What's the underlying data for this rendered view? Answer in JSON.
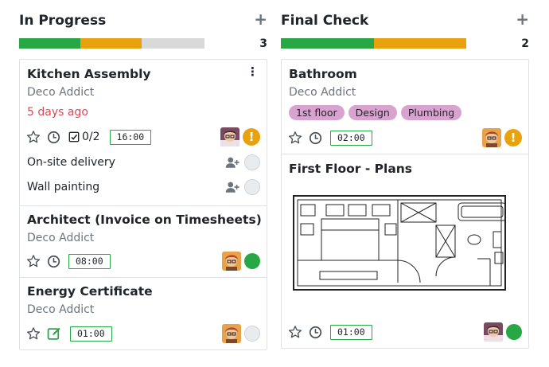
{
  "columns": [
    {
      "title": "In Progress",
      "count": "3",
      "add_label": "+",
      "progress": {
        "green": 0.33,
        "orange": 0.33
      },
      "cards": [
        {
          "title": "Kitchen Assembly",
          "customer": "Deco Addict",
          "deadline": "5 days ago",
          "menu": "⋮",
          "checklist": "0/2",
          "time": "16:00",
          "priority": "!",
          "subtasks": [
            "On-site delivery",
            "Wall painting"
          ]
        },
        {
          "title": "Architect (Invoice on Timesheets)",
          "customer": "Deco Addict",
          "time": "08:00"
        },
        {
          "title": "Energy Certificate",
          "customer": "Deco Addict",
          "time": "01:00"
        }
      ]
    },
    {
      "title": "Final Check",
      "count": "2",
      "add_label": "+",
      "progress": {
        "green": 0.5,
        "orange": 0.5
      },
      "cards": [
        {
          "title": "Bathroom",
          "customer": "Deco Addict",
          "tags": [
            "1st floor",
            "Design",
            "Plumbing"
          ],
          "time": "02:00",
          "priority": "!"
        },
        {
          "title": "First Floor - Plans",
          "time": "01:00"
        }
      ]
    }
  ],
  "colors": {
    "accent_green": "#28a745",
    "accent_orange": "#e8a20d",
    "late_red": "#d44c59",
    "tag_pink": "#d8a4cf"
  }
}
